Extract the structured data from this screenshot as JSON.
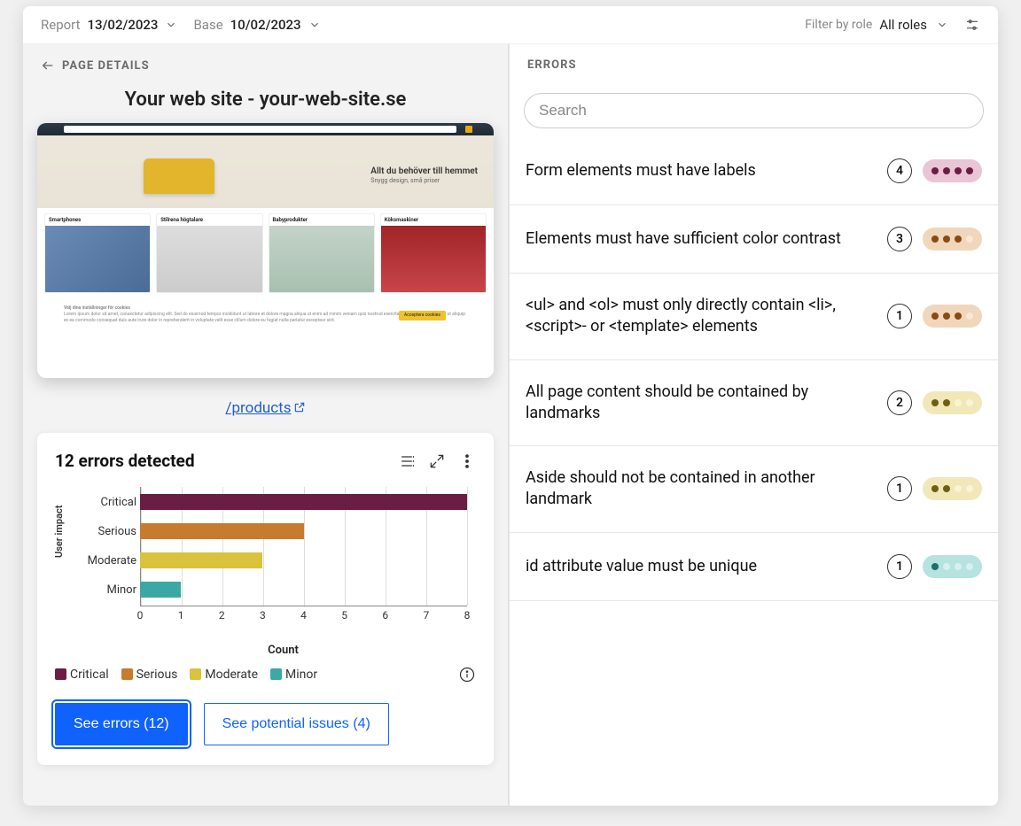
{
  "topbar": {
    "report_label": "Report",
    "report_value": "13/02/2023",
    "base_label": "Base",
    "base_value": "10/02/2023",
    "filter_role_label": "Filter by role",
    "role_value": "All roles"
  },
  "left": {
    "section_title": "PAGE DETAILS",
    "page_title": "Your web site - your-web-site.se",
    "page_url": "/products",
    "screenshot": {
      "hero_title": "Allt du behöver till hemmet",
      "hero_sub": "Snygg design, små priser",
      "products": [
        "Smartphones",
        "Stilrena högtalare",
        "Babyprodukter",
        "Köksmaskiner"
      ],
      "cookie_heading": "Välj dina inställningar för cookies",
      "accept_btn": "Acceptera cookies"
    },
    "errors_card": {
      "title": "12 errors detected",
      "see_errors_label": "See errors (12)",
      "see_potential_label": "See potential issues (4)"
    }
  },
  "right": {
    "section_title": "ERRORS",
    "search_placeholder": "Search",
    "errors": [
      {
        "title": "Form elements must have labels",
        "count": "4",
        "severity": "critical",
        "dots_on": 4
      },
      {
        "title": "Elements must have sufficient color contrast",
        "count": "3",
        "severity": "serious",
        "dots_on": 3
      },
      {
        "title": "<ul> and <ol> must only directly contain <li>, <script>- or <template> elements",
        "count": "1",
        "severity": "serious",
        "dots_on": 3
      },
      {
        "title": "All page content should be contained by landmarks",
        "count": "2",
        "severity": "moderate",
        "dots_on": 2
      },
      {
        "title": "Aside should not be contained in another landmark",
        "count": "1",
        "severity": "moderate",
        "dots_on": 2
      },
      {
        "title": "id attribute value must be unique",
        "count": "1",
        "severity": "minor",
        "dots_on": 1
      }
    ]
  },
  "severity_colors": {
    "critical": "#6b1d44",
    "serious": "#c77b2d",
    "moderate": "#d9c23d",
    "minor": "#3ba8a3"
  },
  "chart_data": {
    "type": "bar",
    "orientation": "horizontal",
    "title": "12 errors detected",
    "xlabel": "Count",
    "ylabel": "User impact",
    "xlim": [
      0,
      8
    ],
    "xticks": [
      0,
      1,
      2,
      3,
      4,
      5,
      6,
      7,
      8
    ],
    "categories": [
      "Critical",
      "Serious",
      "Moderate",
      "Minor"
    ],
    "values": [
      8,
      4,
      3,
      1
    ],
    "colors": [
      "#6b1d44",
      "#c77b2d",
      "#d9c23d",
      "#3ba8a3"
    ],
    "legend": [
      "Critical",
      "Serious",
      "Moderate",
      "Minor"
    ]
  }
}
